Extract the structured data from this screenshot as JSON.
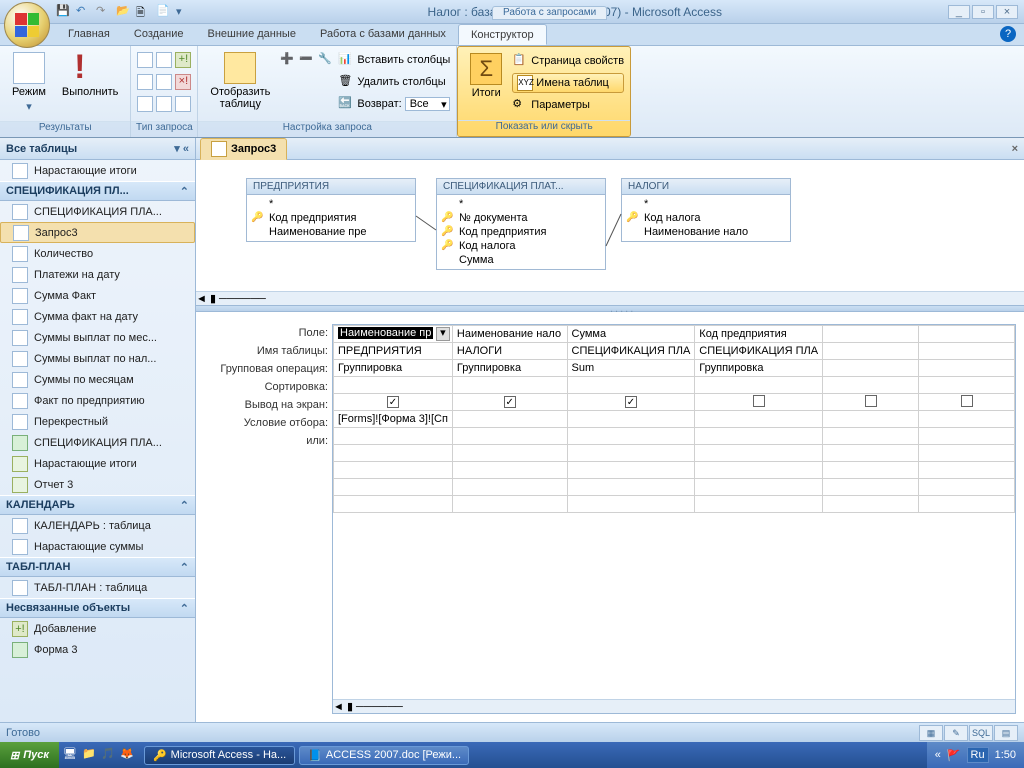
{
  "window": {
    "context_tab": "Работа с запросами",
    "title": "Налог : база данных (Access 2007) - Microsoft Access"
  },
  "tabs": {
    "home": "Главная",
    "create": "Создание",
    "external": "Внешние данные",
    "dbtools": "Работа с базами данных",
    "design": "Конструктор"
  },
  "ribbon": {
    "results": {
      "view": "Режим",
      "run": "Выполнить",
      "label": "Результаты"
    },
    "qtype": {
      "label": "Тип запроса"
    },
    "setup": {
      "show_table": "Отобразить\nтаблицу",
      "ins_cols": "Вставить столбцы",
      "del_cols": "Удалить столбцы",
      "return": "Возврат:",
      "return_val": "Все",
      "label": "Настройка запроса"
    },
    "show": {
      "totals": "Итоги",
      "prop_sheet": "Страница свойств",
      "table_names": "Имена таблиц",
      "params": "Параметры",
      "label": "Показать или скрыть"
    }
  },
  "nav": {
    "title": "Все таблицы",
    "items_top": [
      "Нарастающие итоги"
    ],
    "group1": "СПЕЦИФИКАЦИЯ ПЛ...",
    "items1": [
      "СПЕЦИФИКАЦИЯ ПЛА...",
      "Запрос3",
      "Количество",
      "Платежи на дату",
      "Сумма Факт",
      "Сумма факт на дату",
      "Суммы выплат по мес...",
      "Суммы выплат по нал...",
      "Суммы по месяцам",
      "Факт по предприятию",
      "Перекрестный",
      "СПЕЦИФИКАЦИЯ ПЛА...",
      "Нарастающие итоги",
      "Отчет 3"
    ],
    "group2": "КАЛЕНДАРЬ",
    "items2": [
      "КАЛЕНДАРЬ : таблица",
      "Нарастающие суммы"
    ],
    "group3": "ТАБЛ-ПЛАН",
    "items3": [
      "ТАБЛ-ПЛАН : таблица"
    ],
    "group4": "Несвязанные объекты",
    "items4": [
      "Добавление",
      "Форма 3"
    ]
  },
  "doc": {
    "tab": "Запрос3"
  },
  "tables": {
    "t1": {
      "title": "ПРЕДПРИЯТИЯ",
      "star": "*",
      "f1": "Код предприятия",
      "f2": "Наименование пре"
    },
    "t2": {
      "title": "СПЕЦИФИКАЦИЯ ПЛАТ...",
      "star": "*",
      "f1": "№ документа",
      "f2": "Код предприятия",
      "f3": "Код налога",
      "f4": "Сумма"
    },
    "t3": {
      "title": "НАЛОГИ",
      "star": "*",
      "f1": "Код налога",
      "f2": "Наименование нало"
    }
  },
  "grid": {
    "labels": {
      "field": "Поле:",
      "table": "Имя таблицы:",
      "total": "Групповая операция:",
      "sort": "Сортировка:",
      "show": "Вывод на экран:",
      "crit": "Условие отбора:",
      "or": "или:"
    },
    "cols": [
      {
        "field": "Наименование пр",
        "table": "ПРЕДПРИЯТИЯ",
        "total": "Группировка",
        "show": true,
        "crit": "[Forms]![Форма 3]![Сп"
      },
      {
        "field": "Наименование нало",
        "table": "НАЛОГИ",
        "total": "Группировка",
        "show": true,
        "crit": ""
      },
      {
        "field": "Сумма",
        "table": "СПЕЦИФИКАЦИЯ ПЛА",
        "total": "Sum",
        "show": true,
        "crit": ""
      },
      {
        "field": "Код предприятия",
        "table": "СПЕЦИФИКАЦИЯ ПЛА",
        "total": "Группировка",
        "show": false,
        "crit": ""
      },
      {
        "field": "",
        "table": "",
        "total": "",
        "show": false,
        "crit": ""
      },
      {
        "field": "",
        "table": "",
        "total": "",
        "show": false,
        "crit": ""
      }
    ]
  },
  "status": {
    "ready": "Готово",
    "sql": "SQL"
  },
  "taskbar": {
    "start": "Пуск",
    "task1": "Microsoft Access - На...",
    "task2": "ACCESS 2007.doc [Режи...",
    "lang": "Ru",
    "time": "1:50"
  }
}
